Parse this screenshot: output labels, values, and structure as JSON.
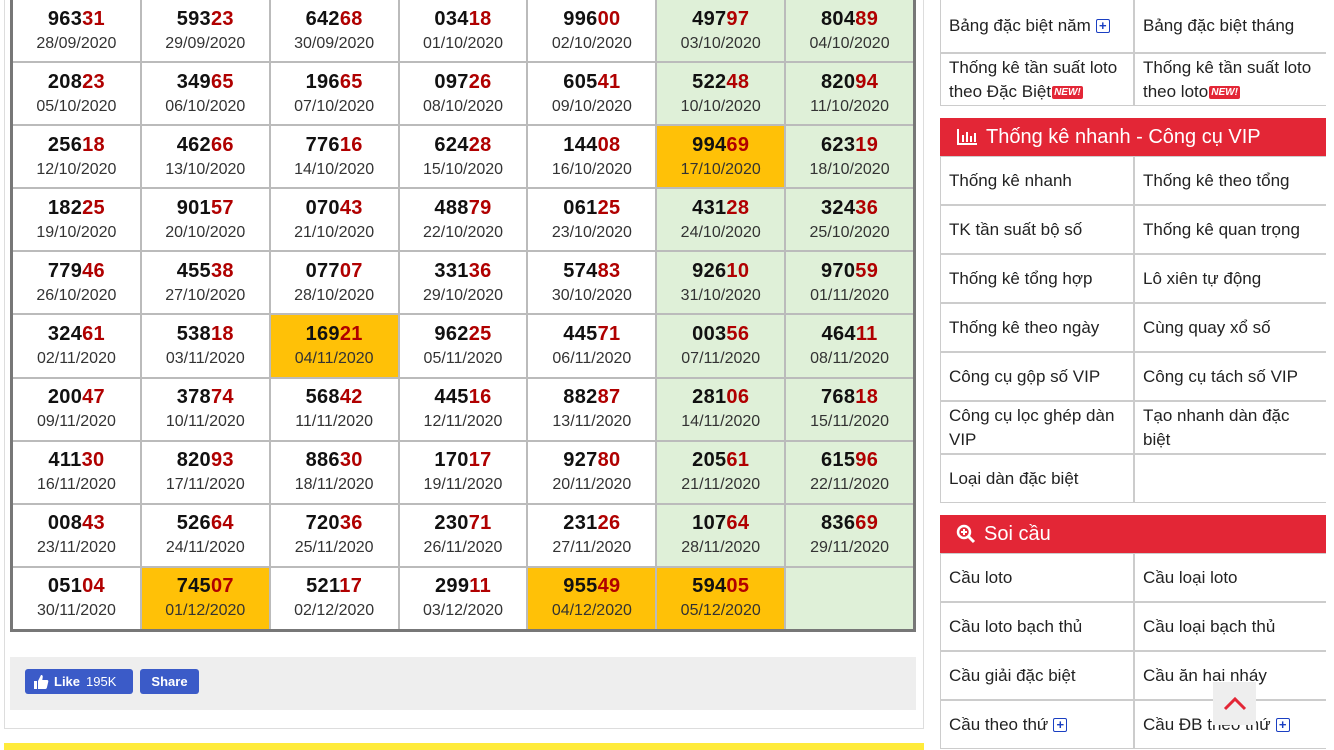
{
  "results": [
    [
      {
        "head": "963",
        "tail": "31",
        "date": "28/09/2020",
        "hl": ""
      },
      {
        "head": "593",
        "tail": "23",
        "date": "29/09/2020",
        "hl": ""
      },
      {
        "head": "642",
        "tail": "68",
        "date": "30/09/2020",
        "hl": ""
      },
      {
        "head": "034",
        "tail": "18",
        "date": "01/10/2020",
        "hl": ""
      },
      {
        "head": "996",
        "tail": "00",
        "date": "02/10/2020",
        "hl": ""
      },
      {
        "head": "497",
        "tail": "97",
        "date": "03/10/2020",
        "hl": "green"
      },
      {
        "head": "804",
        "tail": "89",
        "date": "04/10/2020",
        "hl": "green"
      }
    ],
    [
      {
        "head": "208",
        "tail": "23",
        "date": "05/10/2020",
        "hl": ""
      },
      {
        "head": "349",
        "tail": "65",
        "date": "06/10/2020",
        "hl": ""
      },
      {
        "head": "196",
        "tail": "65",
        "date": "07/10/2020",
        "hl": ""
      },
      {
        "head": "097",
        "tail": "26",
        "date": "08/10/2020",
        "hl": ""
      },
      {
        "head": "605",
        "tail": "41",
        "date": "09/10/2020",
        "hl": ""
      },
      {
        "head": "522",
        "tail": "48",
        "date": "10/10/2020",
        "hl": "green"
      },
      {
        "head": "820",
        "tail": "94",
        "date": "11/10/2020",
        "hl": "green"
      }
    ],
    [
      {
        "head": "256",
        "tail": "18",
        "date": "12/10/2020",
        "hl": ""
      },
      {
        "head": "462",
        "tail": "66",
        "date": "13/10/2020",
        "hl": ""
      },
      {
        "head": "776",
        "tail": "16",
        "date": "14/10/2020",
        "hl": ""
      },
      {
        "head": "624",
        "tail": "28",
        "date": "15/10/2020",
        "hl": ""
      },
      {
        "head": "144",
        "tail": "08",
        "date": "16/10/2020",
        "hl": ""
      },
      {
        "head": "994",
        "tail": "69",
        "date": "17/10/2020",
        "hl": "yellow"
      },
      {
        "head": "623",
        "tail": "19",
        "date": "18/10/2020",
        "hl": "green"
      }
    ],
    [
      {
        "head": "182",
        "tail": "25",
        "date": "19/10/2020",
        "hl": ""
      },
      {
        "head": "901",
        "tail": "57",
        "date": "20/10/2020",
        "hl": ""
      },
      {
        "head": "070",
        "tail": "43",
        "date": "21/10/2020",
        "hl": ""
      },
      {
        "head": "488",
        "tail": "79",
        "date": "22/10/2020",
        "hl": ""
      },
      {
        "head": "061",
        "tail": "25",
        "date": "23/10/2020",
        "hl": ""
      },
      {
        "head": "431",
        "tail": "28",
        "date": "24/10/2020",
        "hl": "green"
      },
      {
        "head": "324",
        "tail": "36",
        "date": "25/10/2020",
        "hl": "green"
      }
    ],
    [
      {
        "head": "779",
        "tail": "46",
        "date": "26/10/2020",
        "hl": ""
      },
      {
        "head": "455",
        "tail": "38",
        "date": "27/10/2020",
        "hl": ""
      },
      {
        "head": "077",
        "tail": "07",
        "date": "28/10/2020",
        "hl": ""
      },
      {
        "head": "331",
        "tail": "36",
        "date": "29/10/2020",
        "hl": ""
      },
      {
        "head": "574",
        "tail": "83",
        "date": "30/10/2020",
        "hl": ""
      },
      {
        "head": "926",
        "tail": "10",
        "date": "31/10/2020",
        "hl": "green"
      },
      {
        "head": "970",
        "tail": "59",
        "date": "01/11/2020",
        "hl": "green"
      }
    ],
    [
      {
        "head": "324",
        "tail": "61",
        "date": "02/11/2020",
        "hl": ""
      },
      {
        "head": "538",
        "tail": "18",
        "date": "03/11/2020",
        "hl": ""
      },
      {
        "head": "169",
        "tail": "21",
        "date": "04/11/2020",
        "hl": "yellow"
      },
      {
        "head": "962",
        "tail": "25",
        "date": "05/11/2020",
        "hl": ""
      },
      {
        "head": "445",
        "tail": "71",
        "date": "06/11/2020",
        "hl": ""
      },
      {
        "head": "003",
        "tail": "56",
        "date": "07/11/2020",
        "hl": "green"
      },
      {
        "head": "464",
        "tail": "11",
        "date": "08/11/2020",
        "hl": "green"
      }
    ],
    [
      {
        "head": "200",
        "tail": "47",
        "date": "09/11/2020",
        "hl": ""
      },
      {
        "head": "378",
        "tail": "74",
        "date": "10/11/2020",
        "hl": ""
      },
      {
        "head": "568",
        "tail": "42",
        "date": "11/11/2020",
        "hl": ""
      },
      {
        "head": "445",
        "tail": "16",
        "date": "12/11/2020",
        "hl": ""
      },
      {
        "head": "882",
        "tail": "87",
        "date": "13/11/2020",
        "hl": ""
      },
      {
        "head": "281",
        "tail": "06",
        "date": "14/11/2020",
        "hl": "green"
      },
      {
        "head": "768",
        "tail": "18",
        "date": "15/11/2020",
        "hl": "green"
      }
    ],
    [
      {
        "head": "411",
        "tail": "30",
        "date": "16/11/2020",
        "hl": ""
      },
      {
        "head": "820",
        "tail": "93",
        "date": "17/11/2020",
        "hl": ""
      },
      {
        "head": "886",
        "tail": "30",
        "date": "18/11/2020",
        "hl": ""
      },
      {
        "head": "170",
        "tail": "17",
        "date": "19/11/2020",
        "hl": ""
      },
      {
        "head": "927",
        "tail": "80",
        "date": "20/11/2020",
        "hl": ""
      },
      {
        "head": "205",
        "tail": "61",
        "date": "21/11/2020",
        "hl": "green"
      },
      {
        "head": "615",
        "tail": "96",
        "date": "22/11/2020",
        "hl": "green"
      }
    ],
    [
      {
        "head": "008",
        "tail": "43",
        "date": "23/11/2020",
        "hl": ""
      },
      {
        "head": "526",
        "tail": "64",
        "date": "24/11/2020",
        "hl": ""
      },
      {
        "head": "720",
        "tail": "36",
        "date": "25/11/2020",
        "hl": ""
      },
      {
        "head": "230",
        "tail": "71",
        "date": "26/11/2020",
        "hl": ""
      },
      {
        "head": "231",
        "tail": "26",
        "date": "27/11/2020",
        "hl": ""
      },
      {
        "head": "107",
        "tail": "64",
        "date": "28/11/2020",
        "hl": "green"
      },
      {
        "head": "836",
        "tail": "69",
        "date": "29/11/2020",
        "hl": "green"
      }
    ],
    [
      {
        "head": "051",
        "tail": "04",
        "date": "30/11/2020",
        "hl": ""
      },
      {
        "head": "745",
        "tail": "07",
        "date": "01/12/2020",
        "hl": "yellow"
      },
      {
        "head": "521",
        "tail": "17",
        "date": "02/12/2020",
        "hl": ""
      },
      {
        "head": "299",
        "tail": "11",
        "date": "03/12/2020",
        "hl": ""
      },
      {
        "head": "955",
        "tail": "49",
        "date": "04/12/2020",
        "hl": "yellow"
      },
      {
        "head": "594",
        "tail": "05",
        "date": "05/12/2020",
        "hl": "yellow"
      },
      {
        "head": "",
        "tail": "",
        "date": "",
        "hl": "green"
      }
    ]
  ],
  "facebook": {
    "like_label": "Like",
    "like_count": "195K",
    "share_label": "Share"
  },
  "top_links": {
    "special_year": "Bảng đặc biệt năm",
    "special_month": "Bảng đặc biệt tháng",
    "freq_loto_special": "Thống kê tần suất loto theo Đặc Biệt",
    "freq_loto": "Thống kê tần suất loto theo loto",
    "new_badge": "NEW!"
  },
  "vip_section": {
    "title": "Thống kê nhanh - Công cụ VIP",
    "items": [
      "Thống kê nhanh",
      "Thống kê theo tổng",
      "TK tần suất bộ số",
      "Thống kê quan trọng",
      "Thống kê tổng hợp",
      "Lô xiên tự động",
      "Thống kê theo ngày",
      "Cùng quay xổ số",
      "Công cụ gộp số VIP",
      "Công cụ tách số VIP",
      "Công cụ lọc ghép dàn VIP",
      "Tạo nhanh dàn đặc biệt",
      "Loại dàn đặc biệt",
      ""
    ]
  },
  "soi_section": {
    "title": "Soi cầu",
    "items": [
      "Cầu loto",
      "Cầu loại loto",
      "Cầu loto bạch thủ",
      "Cầu loại bạch thủ",
      "Cầu giải đặc biệt",
      "Cầu ăn hai nháy",
      "Cầu theo thứ",
      "Cầu ĐB theo thứ"
    ]
  },
  "colors": {
    "accent": "#e32636",
    "tail": "#b00000",
    "green": "#dff0d8",
    "yellow": "#ffc107",
    "fb": "#3b5bc8"
  }
}
